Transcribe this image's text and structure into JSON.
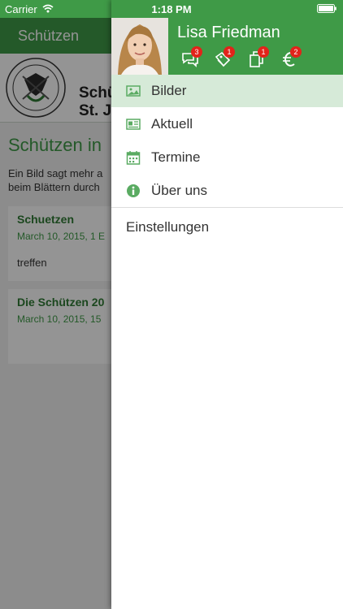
{
  "status_bar": {
    "carrier": "Carrier",
    "time": "1:18 PM"
  },
  "background": {
    "nav_title": "Schützen",
    "banner": {
      "line1": "Schü",
      "line2": "St. Jo"
    },
    "heading": "Schützen in",
    "intro_line1": "Ein Bild sagt mehr a",
    "intro_line2": "beim Blättern durch",
    "cards": [
      {
        "title": "Schuetzen",
        "date": "March 10, 2015, 1 E",
        "body": "treffen"
      },
      {
        "title": "Die Schützen 20",
        "date": "March 10, 2015, 15",
        "body": ""
      }
    ]
  },
  "drawer": {
    "user_name": "Lisa Friedman",
    "header_icons": [
      {
        "icon": "chat-bubbles-icon",
        "badge": "3"
      },
      {
        "icon": "tag-icon",
        "badge": "1"
      },
      {
        "icon": "documents-icon",
        "badge": "1"
      },
      {
        "icon": "euro-icon",
        "badge": "2"
      }
    ],
    "menu": [
      {
        "label": "Bilder",
        "icon": "image-icon",
        "active": true
      },
      {
        "label": "Aktuell",
        "icon": "newspaper-icon",
        "active": false
      },
      {
        "label": "Termine",
        "icon": "calendar-icon",
        "active": false
      },
      {
        "label": "Über uns",
        "icon": "info-icon",
        "active": false
      }
    ],
    "settings_label": "Einstellungen"
  },
  "colors": {
    "brand_green": "#3f9a47",
    "active_row": "#d6ead8",
    "badge_red": "#e2231a"
  }
}
